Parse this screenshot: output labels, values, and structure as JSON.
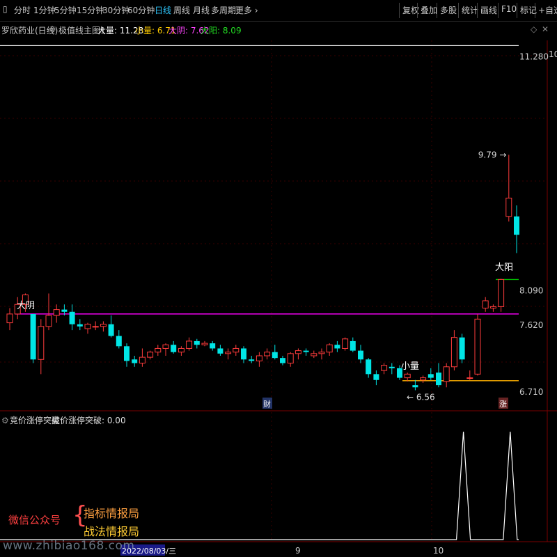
{
  "toolbar": {
    "items": [
      "分时",
      "1分钟",
      "5分钟",
      "15分钟",
      "30分钟",
      "60分钟",
      "日线",
      "周线",
      "月线",
      "多周期",
      "更多"
    ],
    "active_index": 6,
    "right_items": [
      "复权",
      "叠加",
      "多股",
      "统计",
      "画线",
      "F10",
      "标记",
      "+自选"
    ]
  },
  "info": {
    "stock": "罗欣药业(日线)",
    "indicator": "极值线主图1",
    "big_label": "大量: 11.28",
    "small_label": "小量: 6.71",
    "yin_label": "大阴: 7.62",
    "yang_label": "大阳: 8.09"
  },
  "sub_info": {
    "title": "竞价涨停突破",
    "value_label": "竞价涨停突破: 0.00"
  },
  "annotations": {
    "high": "9.79",
    "low": "6.56",
    "big_yin": "大阴",
    "big_yang": "大阳",
    "small_vol": "小量",
    "cai": "财",
    "zhang": "涨"
  },
  "axis": {
    "right_labels": [
      "11.280",
      "8.090",
      "7.620",
      "6.710"
    ],
    "edge_label": "10",
    "x_labels": [
      "9",
      "10"
    ],
    "date_box": "2022/08/03/三"
  },
  "promo": {
    "wechat": "微信公众号",
    "line1": "指标情报局",
    "line2": "战法情报局",
    "watermark": "www.zhibiao168.com"
  },
  "colors": {
    "up": "#ff3c3c",
    "down": "#00e5e5",
    "magenta": "#ff00ff",
    "green": "#00c000",
    "orange": "#ffb000",
    "white": "#ffffff"
  },
  "chart_data": {
    "type": "candlestick",
    "ylim": [
      6.3,
      11.35
    ],
    "levels": {
      "big_volume": 11.28,
      "big_yang": 8.09,
      "big_yin": 7.62,
      "small_volume": 6.71
    },
    "candles": [
      [
        7.5,
        7.7,
        7.4,
        7.62
      ],
      [
        7.62,
        7.85,
        7.55,
        7.75
      ],
      [
        7.75,
        7.9,
        7.65,
        7.88
      ],
      [
        7.62,
        7.62,
        6.95,
        7.0
      ],
      [
        7.0,
        7.55,
        6.8,
        7.45
      ],
      [
        7.45,
        7.9,
        7.4,
        7.6
      ],
      [
        7.6,
        7.75,
        7.5,
        7.68
      ],
      [
        7.68,
        7.75,
        7.6,
        7.65
      ],
      [
        7.65,
        7.75,
        7.4,
        7.48
      ],
      [
        7.48,
        7.55,
        7.4,
        7.45
      ],
      [
        7.42,
        7.5,
        7.35,
        7.48
      ],
      [
        7.45,
        7.52,
        7.4,
        7.45
      ],
      [
        7.45,
        7.52,
        7.38,
        7.48
      ],
      [
        7.48,
        7.6,
        7.3,
        7.32
      ],
      [
        7.32,
        7.4,
        7.15,
        7.18
      ],
      [
        7.18,
        7.22,
        6.9,
        6.98
      ],
      [
        7.0,
        7.05,
        6.9,
        6.95
      ],
      [
        6.95,
        7.15,
        6.9,
        7.03
      ],
      [
        7.03,
        7.12,
        7.0,
        7.1
      ],
      [
        7.1,
        7.2,
        7.05,
        7.15
      ],
      [
        7.15,
        7.22,
        7.05,
        7.2
      ],
      [
        7.2,
        7.25,
        7.08,
        7.1
      ],
      [
        7.1,
        7.18,
        7.05,
        7.15
      ],
      [
        7.15,
        7.3,
        7.12,
        7.25
      ],
      [
        7.25,
        7.28,
        7.15,
        7.2
      ],
      [
        7.2,
        7.25,
        7.18,
        7.22
      ],
      [
        7.22,
        7.25,
        7.12,
        7.15
      ],
      [
        7.15,
        7.2,
        7.05,
        7.08
      ],
      [
        7.08,
        7.15,
        7.0,
        7.1
      ],
      [
        7.1,
        7.2,
        7.05,
        7.15
      ],
      [
        7.15,
        7.18,
        6.95,
        7.0
      ],
      [
        7.0,
        7.05,
        6.95,
        6.98
      ],
      [
        6.98,
        7.1,
        6.9,
        7.05
      ],
      [
        7.05,
        7.15,
        7.0,
        7.1
      ],
      [
        7.1,
        7.2,
        7.0,
        7.02
      ],
      [
        7.02,
        7.05,
        6.92,
        6.95
      ],
      [
        6.95,
        7.1,
        6.9,
        7.08
      ],
      [
        7.08,
        7.15,
        7.0,
        7.12
      ],
      [
        7.12,
        7.15,
        7.05,
        7.1
      ],
      [
        7.05,
        7.12,
        7.02,
        7.08
      ],
      [
        7.08,
        7.15,
        7.0,
        7.1
      ],
      [
        7.1,
        7.22,
        7.05,
        7.2
      ],
      [
        7.2,
        7.25,
        7.1,
        7.15
      ],
      [
        7.15,
        7.3,
        7.12,
        7.28
      ],
      [
        7.25,
        7.3,
        7.1,
        7.12
      ],
      [
        7.12,
        7.2,
        6.95,
        7.0
      ],
      [
        7.0,
        7.02,
        6.75,
        6.8
      ],
      [
        6.8,
        6.85,
        6.65,
        6.72
      ],
      [
        6.85,
        6.95,
        6.8,
        6.92
      ],
      [
        6.9,
        6.95,
        6.8,
        6.88
      ],
      [
        6.88,
        6.92,
        6.72,
        6.75
      ],
      [
        6.75,
        6.82,
        6.7,
        6.8
      ],
      [
        6.65,
        6.72,
        6.58,
        6.62
      ],
      [
        6.72,
        6.78,
        6.68,
        6.75
      ],
      [
        6.8,
        6.88,
        6.72,
        6.75
      ],
      [
        6.82,
        6.95,
        6.62,
        6.65
      ],
      [
        6.7,
        6.95,
        6.62,
        6.9
      ],
      [
        6.9,
        7.4,
        6.85,
        7.3
      ],
      [
        7.3,
        7.35,
        6.95,
        7.0
      ],
      [
        6.75,
        6.85,
        6.72,
        6.75
      ],
      [
        6.8,
        7.62,
        6.78,
        7.55
      ],
      [
        7.7,
        7.85,
        7.65,
        7.8
      ],
      [
        7.7,
        7.75,
        7.65,
        7.72
      ],
      [
        7.72,
        8.1,
        7.65,
        8.09
      ],
      [
        8.95,
        9.79,
        8.88,
        9.2
      ],
      [
        8.95,
        9.1,
        8.45,
        8.7
      ]
    ],
    "indicator": {
      "name": "竞价涨停突破",
      "ylim": [
        0,
        1
      ],
      "spikes_at_candle_index": [
        58,
        64
      ]
    }
  }
}
